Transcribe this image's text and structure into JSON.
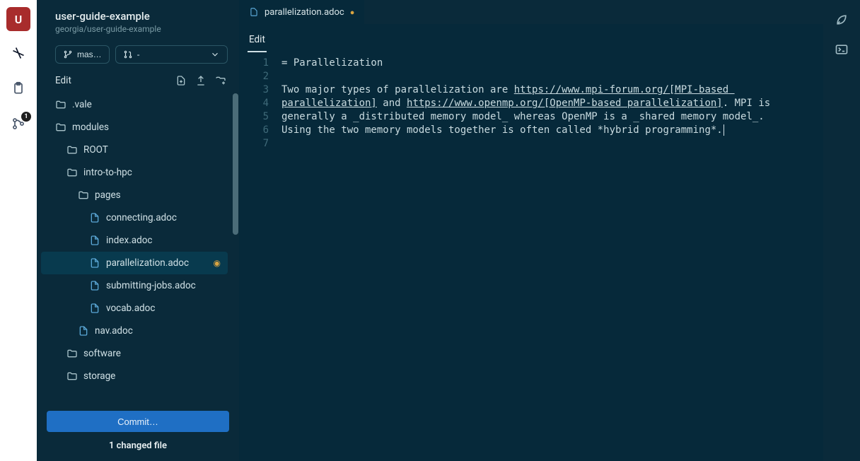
{
  "project": {
    "avatar_letter": "U",
    "name": "user-guide-example",
    "path": "georgia/user-guide-example"
  },
  "branch": {
    "label": "mas…",
    "mr_label": "-"
  },
  "sidebar": {
    "edit_label": "Edit",
    "commit_label": "Commit…",
    "changed_label": "1 changed file",
    "tree": [
      {
        "type": "folder",
        "name": ".vale",
        "depth": 0
      },
      {
        "type": "folder",
        "name": "modules",
        "depth": 0
      },
      {
        "type": "folder",
        "name": "ROOT",
        "depth": 1
      },
      {
        "type": "folder",
        "name": "intro-to-hpc",
        "depth": 1
      },
      {
        "type": "folder",
        "name": "pages",
        "depth": 2
      },
      {
        "type": "file",
        "name": "connecting.adoc",
        "depth": 3
      },
      {
        "type": "file",
        "name": "index.adoc",
        "depth": 3
      },
      {
        "type": "file",
        "name": "parallelization.adoc",
        "depth": 3,
        "selected": true,
        "modified": true
      },
      {
        "type": "file",
        "name": "submitting-jobs.adoc",
        "depth": 3
      },
      {
        "type": "file",
        "name": "vocab.adoc",
        "depth": 3
      },
      {
        "type": "file",
        "name": "nav.adoc",
        "depth": 2
      },
      {
        "type": "folder",
        "name": "software",
        "depth": 1
      },
      {
        "type": "folder",
        "name": "storage",
        "depth": 1
      }
    ]
  },
  "tabs": {
    "active": {
      "label": "parallelization.adoc",
      "modified": true
    }
  },
  "editor_toolbar": {
    "mode": "Edit"
  },
  "source_control_badge": "1",
  "code": {
    "title_line": "= Parallelization",
    "body_pre": "Two major types of parallelization are ",
    "link1": "https://www.mpi-forum.org/[MPI-based parallelization]",
    "mid1": " and ",
    "link2": "https://www.openmp.org/[OpenMP-based parallelization]",
    "rest": ". MPI is generally a _distributed memory model_ whereas OpenMP is a _shared memory model_. Using the two memory models together is often called *hybrid programming*."
  }
}
